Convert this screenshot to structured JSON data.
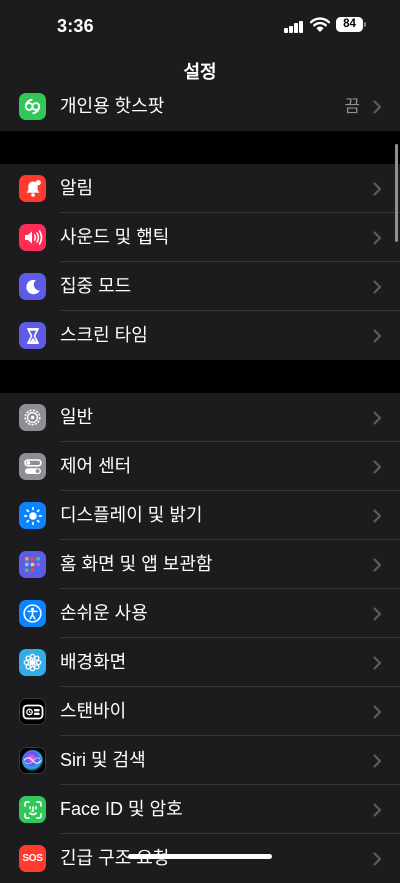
{
  "status_bar": {
    "time": "3:36",
    "battery": "84"
  },
  "nav": {
    "title": "설정"
  },
  "hotspot": {
    "label": "개인용 핫스팟",
    "value": "끔",
    "icon": "hotspot-icon",
    "color": "#32c759"
  },
  "groups": [
    [
      {
        "label": "알림",
        "icon": "bell-icon",
        "color": "#ff3b30"
      },
      {
        "label": "사운드 및 햅틱",
        "icon": "speaker-icon",
        "color": "#ff2d55"
      },
      {
        "label": "집중 모드",
        "icon": "moon-icon",
        "color": "#5e5ce6"
      },
      {
        "label": "스크린 타임",
        "icon": "hourglass-icon",
        "color": "#5e5ce6"
      }
    ],
    [
      {
        "label": "일반",
        "icon": "gear-icon",
        "color": "#8e8e93"
      },
      {
        "label": "제어 센터",
        "icon": "toggles-icon",
        "color": "#8e8e93"
      },
      {
        "label": "디스플레이 및 밝기",
        "icon": "sun-icon",
        "color": "#0a84ff"
      },
      {
        "label": "홈 화면 및 앱 보관함",
        "icon": "app-grid-icon",
        "color": "#5e5ce6"
      },
      {
        "label": "손쉬운 사용",
        "icon": "accessibility-icon",
        "color": "#0a84ff"
      },
      {
        "label": "배경화면",
        "icon": "flower-icon",
        "color": "#32ade6"
      },
      {
        "label": "스탠바이",
        "icon": "standby-icon",
        "color": "#000000"
      },
      {
        "label": "Siri 및 검색",
        "icon": "siri-icon",
        "color": "#000000"
      },
      {
        "label": "Face ID 및 암호",
        "icon": "face-id-icon",
        "color": "#32c759"
      },
      {
        "label": "긴급 구조 요청",
        "icon": "sos-icon",
        "color": "#ff3b30",
        "icon_text": "SOS"
      }
    ]
  ]
}
